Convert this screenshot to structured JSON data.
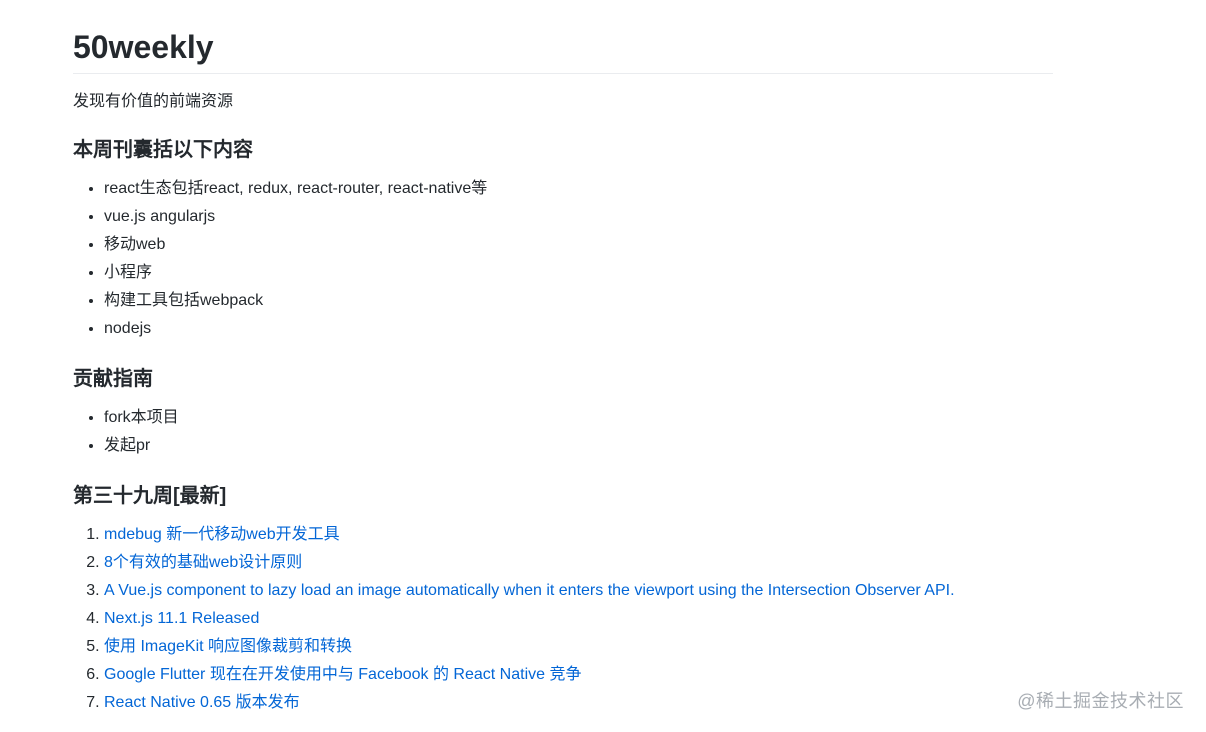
{
  "title": "50weekly",
  "subtitle": "发现有价值的前端资源",
  "contents_section": {
    "heading": "本周刊囊括以下内容",
    "items": [
      "react生态包括react, redux, react-router, react-native等",
      "vue.js angularjs",
      "移动web",
      "小程序",
      "构建工具包括webpack",
      "nodejs"
    ]
  },
  "contribute_section": {
    "heading": "贡献指南",
    "items": [
      "fork本项目",
      "发起pr"
    ]
  },
  "week_section": {
    "heading": "第三十九周[最新]",
    "links": [
      "mdebug 新一代移动web开发工具",
      "8个有效的基础web设计原则",
      "A Vue.js component to lazy load an image automatically when it enters the viewport using the Intersection Observer API.",
      "Next.js 11.1 Released",
      "使用 ImageKit 响应图像裁剪和转换",
      "Google Flutter 现在在开发使用中与 Facebook 的 React Native 竞争",
      "React Native 0.65 版本发布"
    ]
  },
  "watermark": "@稀土掘金技术社区",
  "colors": {
    "text": "#24292e",
    "link": "#0366d6",
    "divider": "#eaecef",
    "watermark": "#a8adb3"
  }
}
